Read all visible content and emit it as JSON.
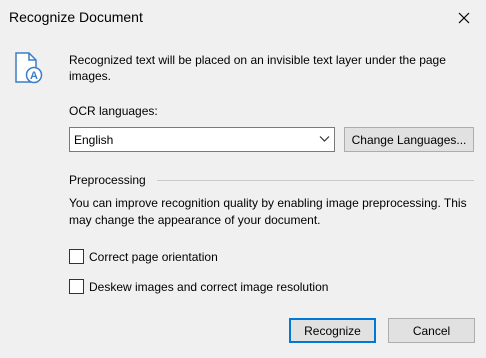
{
  "dialog": {
    "title": "Recognize Document",
    "intro_text": "Recognized text will be placed on an invisible text layer under the page images."
  },
  "ocr": {
    "label": "OCR languages:",
    "selected_language": "English",
    "change_button_label": "Change Languages..."
  },
  "preprocessing": {
    "header": "Preprocessing",
    "description": "You can improve recognition quality by enabling image preprocessing. This may change the appearance of your document.",
    "options": [
      {
        "label": "Correct page orientation",
        "checked": false
      },
      {
        "label": "Deskew images and correct image resolution",
        "checked": false
      }
    ]
  },
  "buttons": {
    "recognize_label": "Recognize",
    "cancel_label": "Cancel"
  },
  "icons": {
    "close": "close-icon",
    "document": "document-ocr-icon",
    "dropdown": "chevron-down-icon"
  },
  "colors": {
    "accent": "#0078d7",
    "icon_blue": "#3c7ec5",
    "dialog_bg": "#f0f0f0"
  }
}
